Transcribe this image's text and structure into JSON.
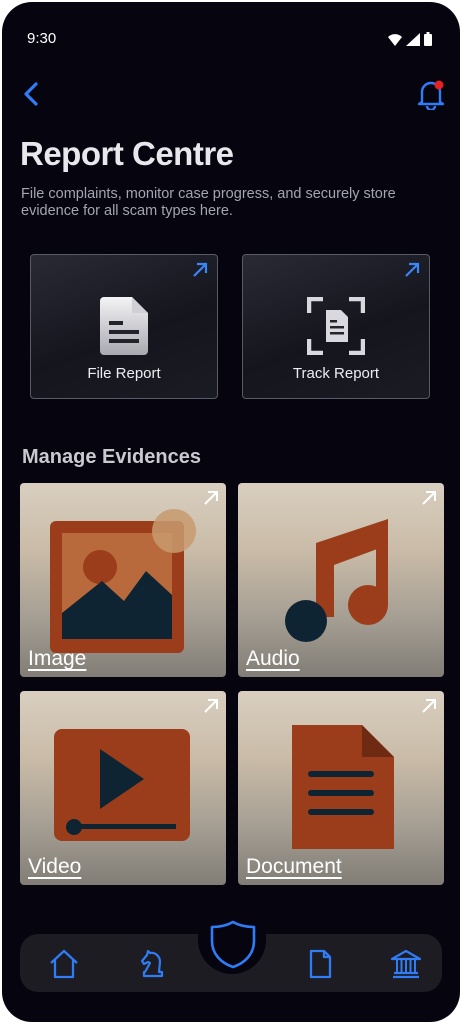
{
  "status_bar": {
    "time": "9:30"
  },
  "header": {
    "title": "Report Centre",
    "subtitle": "File complaints, monitor case progress, and securely store evidence for all scam types here."
  },
  "actions": [
    {
      "label": "File Report",
      "icon": "document-icon"
    },
    {
      "label": "Track Report",
      "icon": "scan-document-icon"
    }
  ],
  "evidence": {
    "section_title": "Manage Evidences",
    "cards": [
      {
        "label": "Image",
        "icon": "image-icon"
      },
      {
        "label": "Audio",
        "icon": "music-note-icon"
      },
      {
        "label": "Video",
        "icon": "video-player-icon"
      },
      {
        "label": "Document",
        "icon": "document-icon"
      }
    ]
  },
  "nav": {
    "items": [
      "home-icon",
      "chess-knight-icon",
      "shield-icon",
      "file-icon",
      "bank-icon"
    ]
  },
  "colors": {
    "background": "#05040f",
    "accent": "#2f7cf6",
    "art": "#9b3d1a",
    "dark_art": "#0e2433",
    "notification_dot": "#e52222"
  }
}
